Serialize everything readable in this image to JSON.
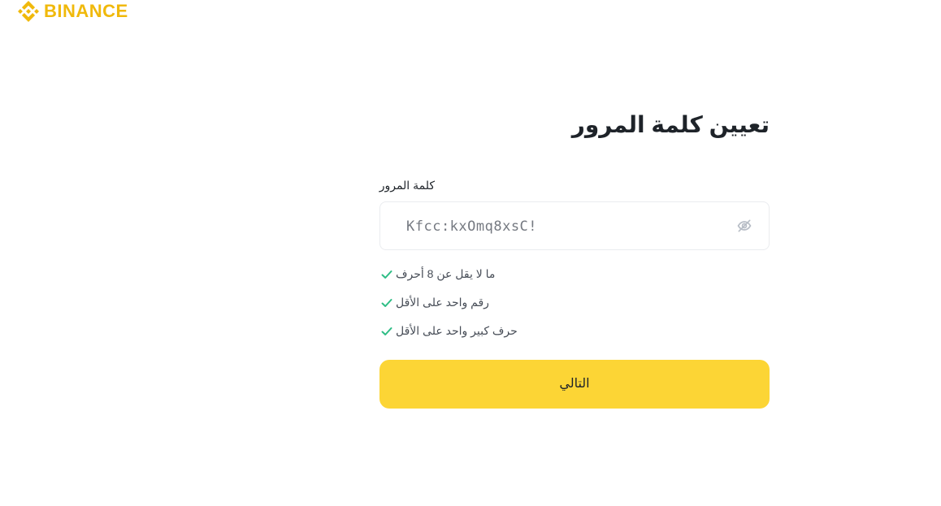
{
  "brand": {
    "name": "BINANCE",
    "color": "#F0B90B",
    "icon": "binance-logo-icon"
  },
  "form": {
    "title": "تعيين كلمة المرور",
    "password_label": "كلمة المرور",
    "password_value": "Kfcc:kxOmq8xsC!",
    "visibility_icon": "eye-slash-icon",
    "rules": [
      {
        "text": "ما لا يقل عن 8 أحرف",
        "icon": "check-icon",
        "satisfied": true
      },
      {
        "text": "رقم واحد على الأقل",
        "icon": "check-icon",
        "satisfied": true
      },
      {
        "text": "حرف كبير واحد على الأقل",
        "icon": "check-icon",
        "satisfied": true
      }
    ],
    "rule_check_color": "#2EBD85",
    "next_label": "التالي",
    "next_color": "#FCD535"
  }
}
